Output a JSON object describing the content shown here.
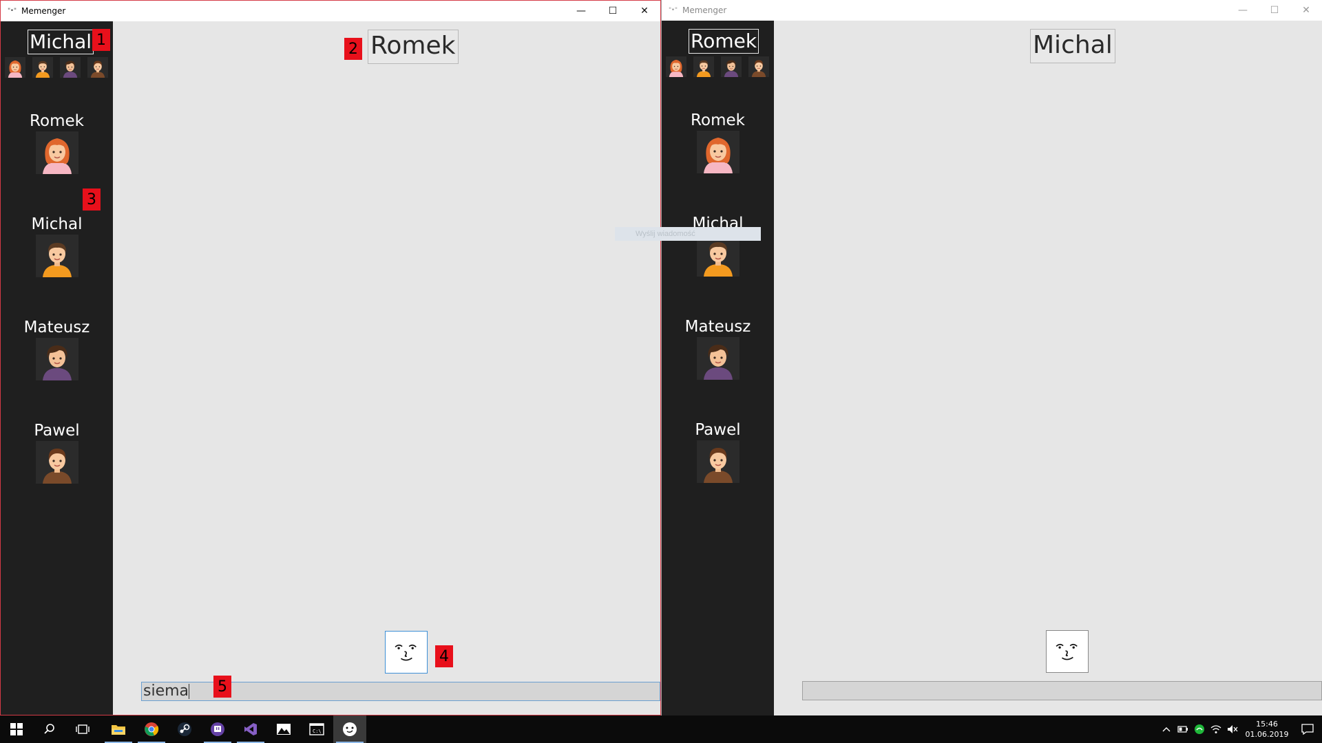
{
  "app": {
    "title": "Memenger",
    "icon_text": "\"•\""
  },
  "window_controls": {
    "minimize": "—",
    "maximize": "☐",
    "close": "✕"
  },
  "left_window": {
    "current_user": "Michal",
    "chat_partner": "Romek",
    "message_input": "siema",
    "contacts": [
      "Romek",
      "Michal",
      "Mateusz",
      "Pawel"
    ]
  },
  "right_window": {
    "current_user": "Romek",
    "chat_partner": "Michal",
    "message_input": "",
    "contacts": [
      "Romek",
      "Michal",
      "Mateusz",
      "Pawel"
    ]
  },
  "annotations": [
    "1",
    "2",
    "3",
    "4",
    "5"
  ],
  "tooltip": "Wyślij wiadomość",
  "clock": {
    "time": "15:46",
    "date": "01.06.2019"
  },
  "colors": {
    "sidebar": "#1f1f1f",
    "content": "#e6e6e6",
    "annotation": "#e8101b",
    "accent_border": "#d43a46"
  },
  "taskbar_icons": [
    "windows-start-icon",
    "search-icon",
    "task-view-icon",
    "file-explorer-icon",
    "chrome-icon",
    "steam-icon",
    "twitch-icon",
    "visual-studio-icon",
    "photos-icon",
    "console-icon",
    "memenger-icon"
  ]
}
